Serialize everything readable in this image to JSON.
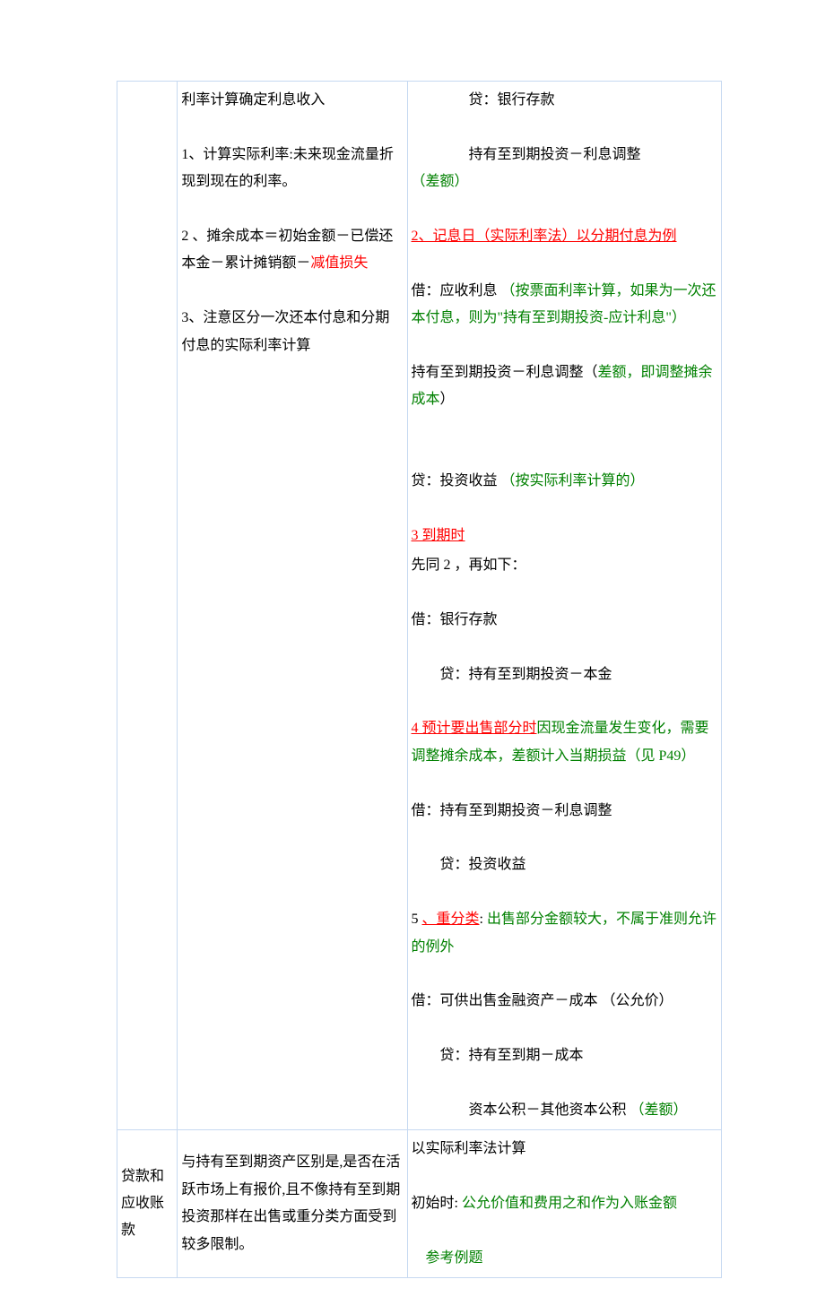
{
  "row1": {
    "col2": {
      "p1": "利率计算确定利息收入",
      "p2": "1、计算实际利率:未来现金流量折现到现在的利率。",
      "p3a": "2 、摊余成本＝初始金额－已偿还本金－累计摊销额－",
      "p3b": "减值损失",
      "p4": "3、注意区分一次还本付息和分期付息的实际利率计算"
    },
    "col3": {
      "l1": "贷：银行存款",
      "l2a": "持有至到期投资－利息调整",
      "l2b": "（差额）",
      "l3": "2、记息日（实际利率法）以分期付息为例",
      "l4a": "借：应收利息   ",
      "l4b": "（按票面利率计算，如果为一次还本付息，则为\"持有至到期投资-应计利息\"）",
      "l5a": "持有至到期投资－利息调整（",
      "l5b": "差额，即调整摊余成本",
      "l5c": "）",
      "l6a": "贷：投资收益       ",
      "l6b": "（按实际利率计算的）",
      "l7": "3 到期时",
      "l8": "先同 2 ，再如下：",
      "l9": "借：银行存款",
      "l10": "贷：持有至到期投资－本金",
      "l11a": "4 预计要出售部分时",
      "l11b": "因现金流量发生变化，需要调整摊余成本，差额计入当期损益（见 P49）",
      "l12": "借：持有至到期投资－利息调整",
      "l13": "贷：投资收益",
      "l14a": " 5 ",
      "l14b": "、重分类",
      "l14c": ":  ",
      "l14d": "出售部分金额较大，不属于准则允许的例外",
      "l15": "借：可供出售金融资产－成本  （公允价）",
      "l16": "贷：持有至到期－成本",
      "l17a": "资本公积－其他资本公积   ",
      "l17b": "（差额）"
    }
  },
  "row2": {
    "col1": "贷款和应收账款",
    "col2": "与持有至到期资产区别是,是否在活跃市场上有报价,且不像持有至到期投资那样在出售或重分类方面受到较多限制。",
    "col3": {
      "p1": "以实际利率法计算",
      "p2a": " 初始时:",
      "p2b": " 公允价值和费用之和作为入账金额",
      "p3": "参考例题"
    }
  }
}
